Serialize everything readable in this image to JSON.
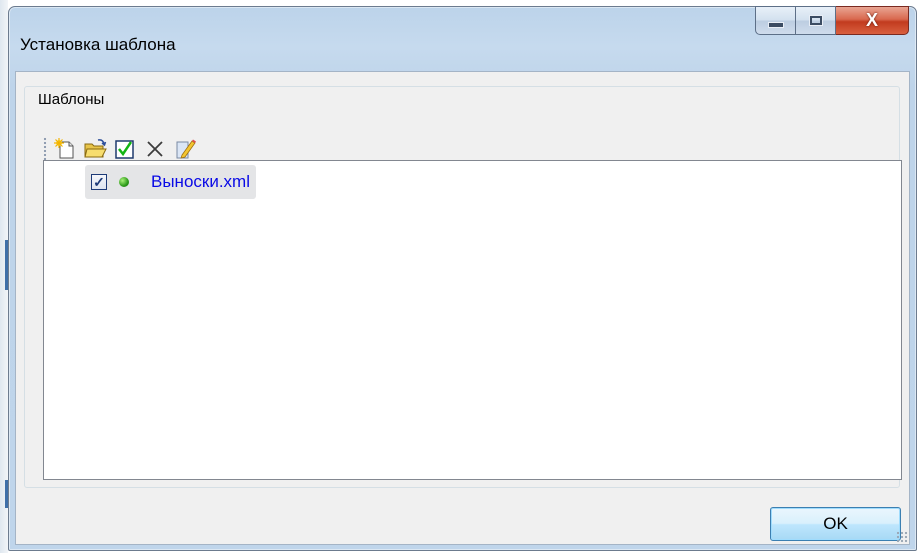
{
  "window": {
    "title": "Установка шаблона",
    "controls": {
      "minimize": "minimize-icon",
      "maximize": "maximize-icon",
      "close": "close-icon",
      "close_glyph": "X"
    }
  },
  "group": {
    "label": "Шаблоны"
  },
  "toolbar": {
    "buttons": [
      {
        "icon": "new-template-icon"
      },
      {
        "icon": "open-folder-icon"
      },
      {
        "icon": "apply-check-icon"
      },
      {
        "icon": "delete-icon"
      },
      {
        "icon": "edit-icon"
      }
    ]
  },
  "templates": [
    {
      "name": "Выноски.xml",
      "checked": true,
      "status_color": "#2d9a1a"
    }
  ],
  "footer": {
    "ok_label": "OK"
  },
  "colors": {
    "item_text": "#0a0ae6",
    "selection": "#e4e5e7",
    "window_frame": "#bfd5eb",
    "close_button": "#c23b1f"
  }
}
